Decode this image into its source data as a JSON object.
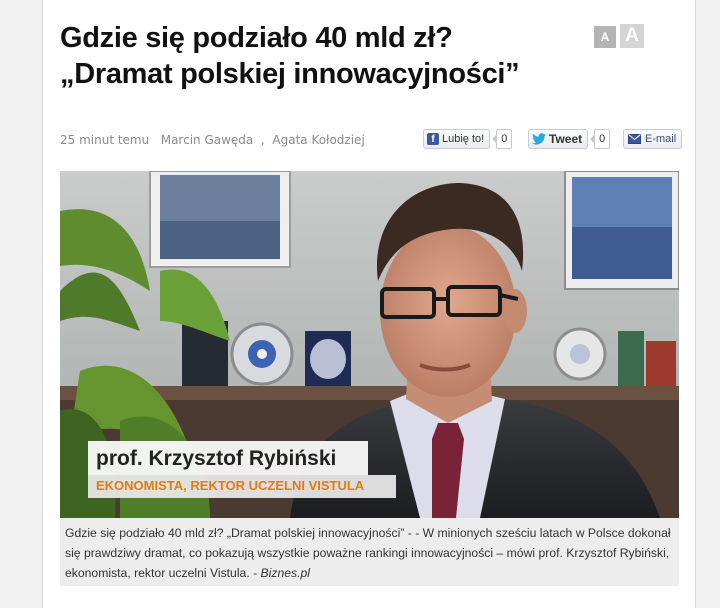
{
  "article": {
    "title_line1": "Gdzie się podziało 40 mld zł?",
    "title_line2": "„Dramat polskiej innowacyjności”",
    "meta": {
      "time": "25 minut temu",
      "author1": "Marcin Gawęda",
      "separator": " , ",
      "author2": "Agata Kołodziej"
    }
  },
  "font_size_buttons": {
    "small": "A",
    "large": "A"
  },
  "social": {
    "facebook": {
      "icon": "facebook-icon",
      "label": "Lubię to!",
      "count": "0"
    },
    "twitter": {
      "icon": "twitter-bird-icon",
      "label": "Tweet",
      "count": "0"
    },
    "email": {
      "icon": "envelope-icon",
      "label": "E-mail"
    }
  },
  "video": {
    "lower_third_name": "prof. Krzysztof Rybiński",
    "lower_third_role": "EKONOMISTA, REKTOR UCZELNI VISTULA"
  },
  "caption": {
    "text": "Gdzie się podziało 40 mld zł? „Dramat polskiej innowacyjności” - - W minionych sześciu latach w Polsce dokonał się prawdziwy dramat, co pokazują wszystkie poważne rankingi innowacyjności – mówi prof. Krzysztof Rybiński, ekonomista, rektor uczelni Vistula. - ",
    "source": "Biznes.pl"
  },
  "colors": {
    "facebook_blue": "#3b5998",
    "twitter_blue": "#2aa9e0",
    "lower_third_role": "#e07b16",
    "caption_bg": "#ededed"
  }
}
